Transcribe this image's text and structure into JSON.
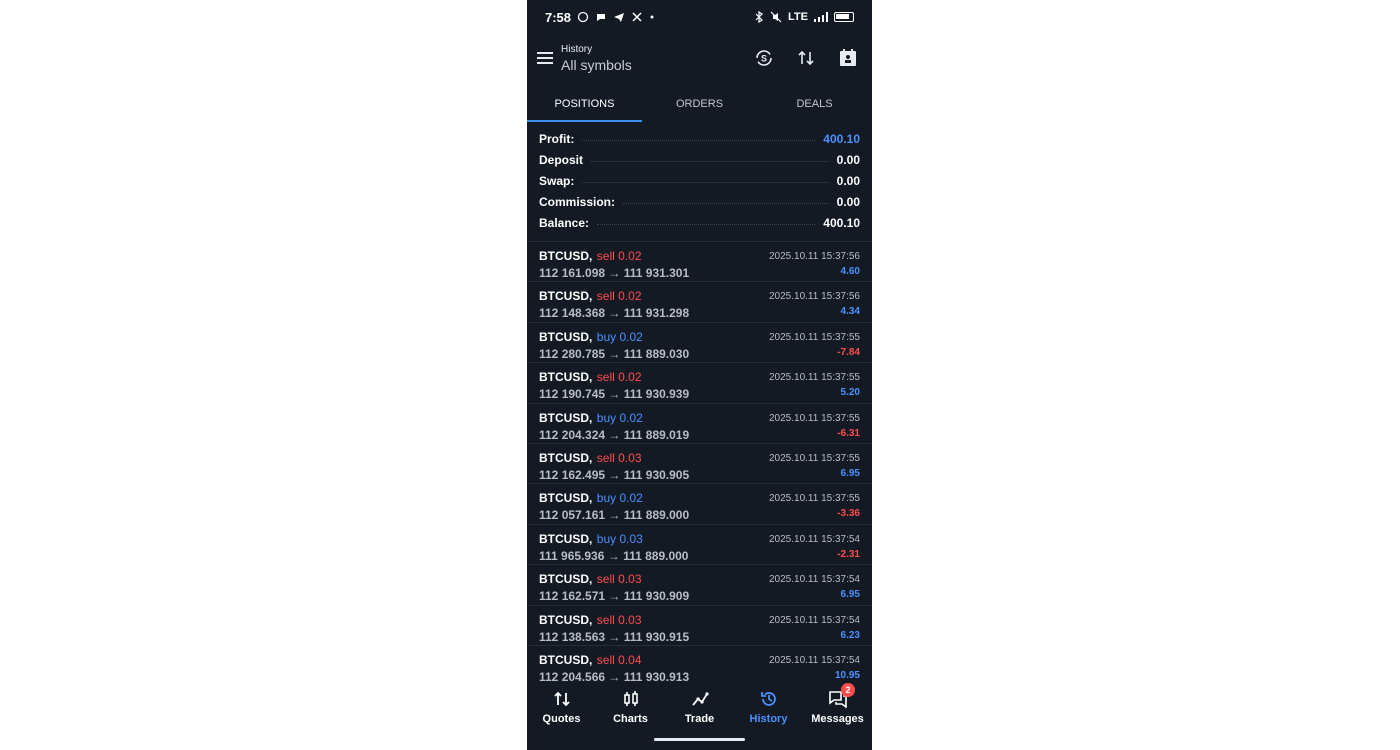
{
  "status_bar": {
    "time": "7:58",
    "network": "LTE"
  },
  "header": {
    "title_small": "History",
    "title_big": "All symbols"
  },
  "tabs": [
    {
      "label": "POSITIONS",
      "active": true
    },
    {
      "label": "ORDERS",
      "active": false
    },
    {
      "label": "DEALS",
      "active": false
    }
  ],
  "summary": [
    {
      "label": "Profit:",
      "value": "400.10",
      "accent": true
    },
    {
      "label": "Deposit",
      "value": "0.00",
      "accent": false
    },
    {
      "label": "Swap:",
      "value": "0.00",
      "accent": false
    },
    {
      "label": "Commission:",
      "value": "0.00",
      "accent": false
    },
    {
      "label": "Balance:",
      "value": "400.10",
      "accent": false
    }
  ],
  "deals": [
    {
      "symbol": "BTCUSD,",
      "side": "sell 0.02",
      "type": "sell",
      "prices": "112 161.098 → 111 931.301",
      "time": "2025.10.11 15:37:56",
      "profit": "4.60",
      "positive": true
    },
    {
      "symbol": "BTCUSD,",
      "side": "sell 0.02",
      "type": "sell",
      "prices": "112 148.368 → 111 931.298",
      "time": "2025.10.11 15:37:56",
      "profit": "4.34",
      "positive": true
    },
    {
      "symbol": "BTCUSD,",
      "side": "buy 0.02",
      "type": "buy",
      "prices": "112 280.785 → 111 889.030",
      "time": "2025.10.11 15:37:55",
      "profit": "-7.84",
      "positive": false
    },
    {
      "symbol": "BTCUSD,",
      "side": "sell 0.02",
      "type": "sell",
      "prices": "112 190.745 → 111 930.939",
      "time": "2025.10.11 15:37:55",
      "profit": "5.20",
      "positive": true
    },
    {
      "symbol": "BTCUSD,",
      "side": "buy 0.02",
      "type": "buy",
      "prices": "112 204.324 → 111 889.019",
      "time": "2025.10.11 15:37:55",
      "profit": "-6.31",
      "positive": false
    },
    {
      "symbol": "BTCUSD,",
      "side": "sell 0.03",
      "type": "sell",
      "prices": "112 162.495 → 111 930.905",
      "time": "2025.10.11 15:37:55",
      "profit": "6.95",
      "positive": true
    },
    {
      "symbol": "BTCUSD,",
      "side": "buy 0.02",
      "type": "buy",
      "prices": "112 057.161 → 111 889.000",
      "time": "2025.10.11 15:37:55",
      "profit": "-3.36",
      "positive": false
    },
    {
      "symbol": "BTCUSD,",
      "side": "buy 0.03",
      "type": "buy",
      "prices": "111 965.936 → 111 889.000",
      "time": "2025.10.11 15:37:54",
      "profit": "-2.31",
      "positive": false
    },
    {
      "symbol": "BTCUSD,",
      "side": "sell 0.03",
      "type": "sell",
      "prices": "112 162.571 → 111 930.909",
      "time": "2025.10.11 15:37:54",
      "profit": "6.95",
      "positive": true
    },
    {
      "symbol": "BTCUSD,",
      "side": "sell 0.03",
      "type": "sell",
      "prices": "112 138.563 → 111 930.915",
      "time": "2025.10.11 15:37:54",
      "profit": "6.23",
      "positive": true
    },
    {
      "symbol": "BTCUSD,",
      "side": "sell 0.04",
      "type": "sell",
      "prices": "112 204.566 → 111 930.913",
      "time": "2025.10.11 15:37:54",
      "profit": "10.95",
      "positive": true
    }
  ],
  "bottom_nav": [
    {
      "label": "Quotes",
      "icon": "quotes-icon",
      "active": false
    },
    {
      "label": "Charts",
      "icon": "charts-icon",
      "active": false
    },
    {
      "label": "Trade",
      "icon": "trade-icon",
      "active": false
    },
    {
      "label": "History",
      "icon": "history-icon",
      "active": true
    },
    {
      "label": "Messages",
      "icon": "messages-icon",
      "active": false,
      "badge": "2"
    }
  ],
  "colors": {
    "background": "#131a24",
    "accent_blue": "#4a90ff",
    "sell_red": "#ff4d4d"
  }
}
